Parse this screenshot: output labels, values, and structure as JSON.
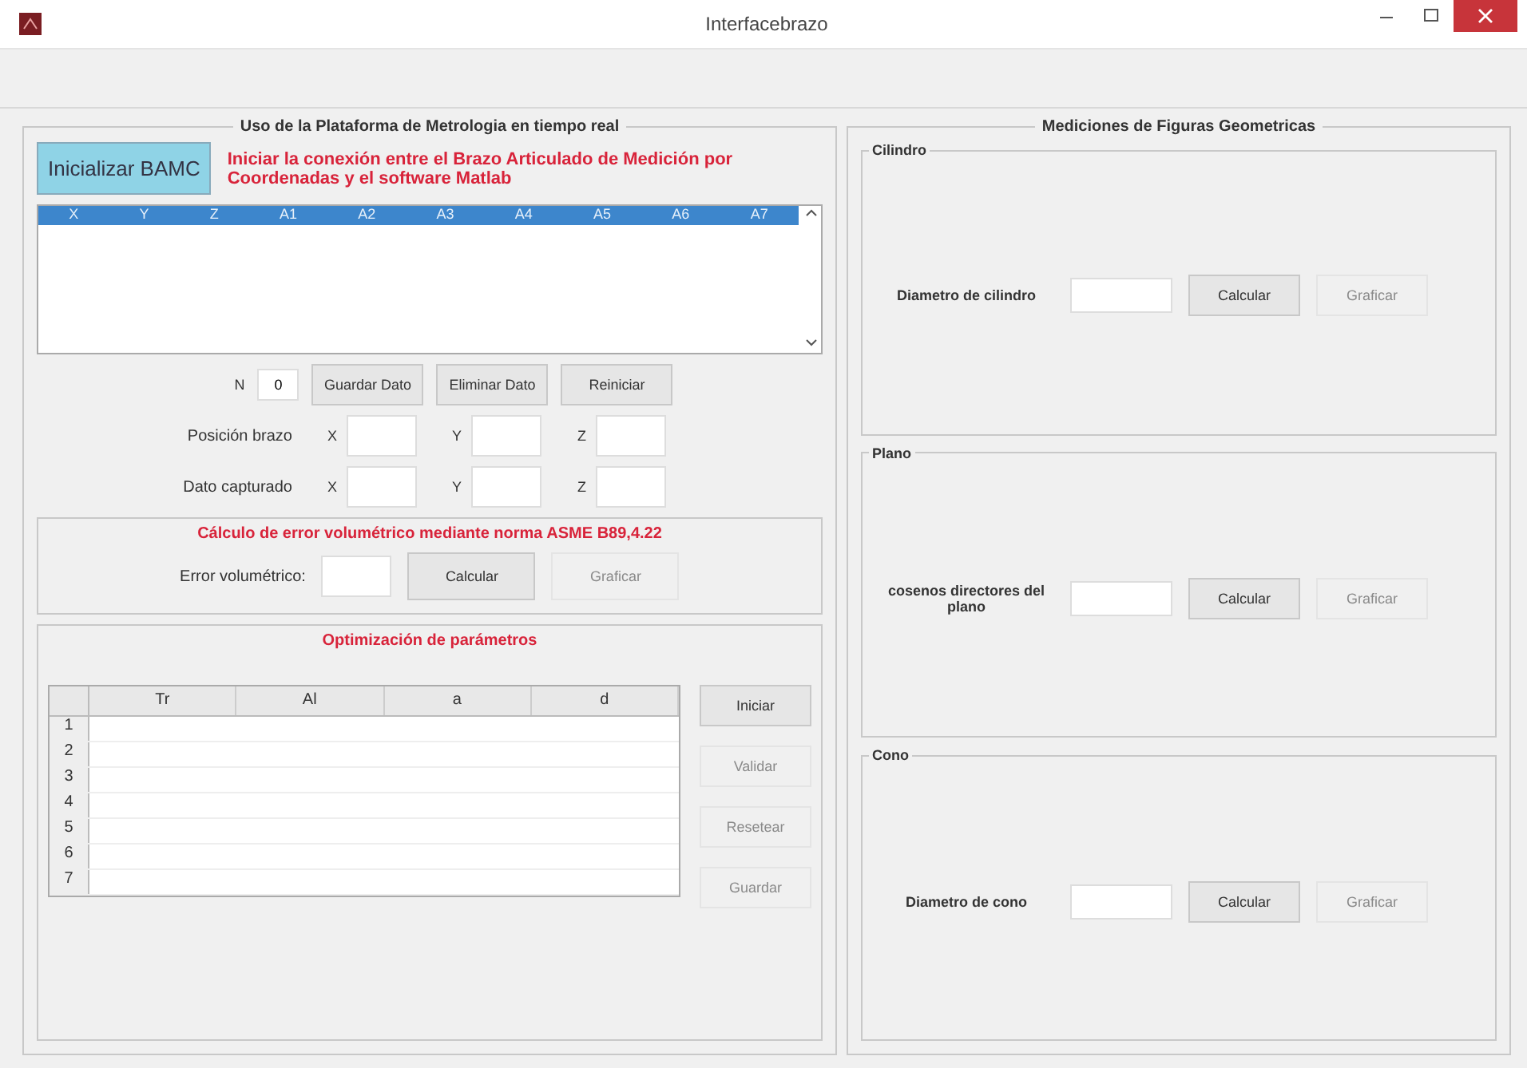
{
  "window": {
    "title": "Interfacebrazo"
  },
  "left_panel": {
    "title": "Uso de la Plataforma de Metrologia en tiempo real",
    "init_button": {
      "label": "Inicializar BAMC",
      "disabled": false
    },
    "init_message": "Iniciar la conexión entre el Brazo Articulado de Medición por Coordenadas y el software Matlab",
    "list_header": [
      "X",
      "Y",
      "Z",
      "A1",
      "A2",
      "A3",
      "A4",
      "A5",
      "A6",
      "A7"
    ],
    "n_label": "N",
    "n_value": "0",
    "buttons": [
      {
        "label": "Guardar Dato",
        "disabled": false
      },
      {
        "label": "Eliminar Dato",
        "disabled": false
      },
      {
        "label": "Reiniciar",
        "disabled": false
      }
    ],
    "position_rows": [
      {
        "label": "Posición brazo",
        "fields": [
          "X",
          "Y",
          "Z"
        ]
      },
      {
        "label": "Dato capturado",
        "fields": [
          "X",
          "Y",
          "Z"
        ]
      }
    ],
    "error_group": {
      "title": "Cálculo de error volumétrico mediante norma ASME B89,4.22",
      "field_label": "Error volumétrico:",
      "buttons": [
        {
          "label": "Calcular",
          "disabled": false
        },
        {
          "label": "Graficar",
          "disabled": true
        }
      ]
    },
    "optimization_group": {
      "title": "Optimización de parámetros",
      "columns": [
        "Tr",
        "Al",
        "a",
        "d"
      ],
      "row_numbers": [
        "1",
        "2",
        "3",
        "4",
        "5",
        "6",
        "7"
      ],
      "buttons": [
        {
          "label": "Iniciar",
          "disabled": false
        },
        {
          "label": "Validar",
          "disabled": true
        },
        {
          "label": "Resetear",
          "disabled": true
        },
        {
          "label": "Guardar",
          "disabled": true
        }
      ]
    }
  },
  "right_panel": {
    "title": "Mediciones de Figuras Geometricas",
    "groups": [
      {
        "title": "Cilindro",
        "label": "Diametro de cilindro",
        "buttons": [
          {
            "label": "Calcular",
            "disabled": false
          },
          {
            "label": "Graficar",
            "disabled": true
          }
        ]
      },
      {
        "title": "Plano",
        "label": "cosenos directores del plano",
        "buttons": [
          {
            "label": "Calcular",
            "disabled": false
          },
          {
            "label": "Graficar",
            "disabled": true
          }
        ]
      },
      {
        "title": "Cono",
        "label": "Diametro de cono",
        "buttons": [
          {
            "label": "Calcular",
            "disabled": false
          },
          {
            "label": "Graficar",
            "disabled": true
          }
        ]
      }
    ]
  }
}
